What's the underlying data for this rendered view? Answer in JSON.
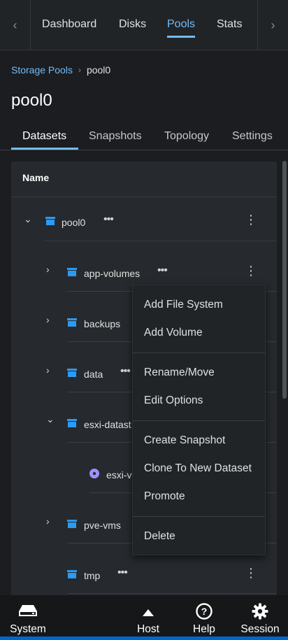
{
  "nav": {
    "tabs": [
      "Dashboard",
      "Disks",
      "Pools",
      "Stats"
    ],
    "active_tab": "Pools"
  },
  "breadcrumb": {
    "parent": "Storage Pools",
    "current": "pool0"
  },
  "page": {
    "title": "pool0"
  },
  "subtabs": [
    "Datasets",
    "Snapshots",
    "Topology",
    "Settings"
  ],
  "table": {
    "header": "Name"
  },
  "tree": {
    "root": "pool0",
    "children": [
      {
        "label": "app-volumes"
      },
      {
        "label": "backups"
      },
      {
        "label": "data"
      },
      {
        "label": "esxi-datast"
      },
      {
        "label": "esxi-v"
      },
      {
        "label": "pve-vms"
      },
      {
        "label": "tmp"
      }
    ]
  },
  "menu": {
    "items": [
      "Add File System",
      "Add Volume",
      "Rename/Move",
      "Edit Options",
      "Create Snapshot",
      "Clone To New Dataset",
      "Promote",
      "Delete"
    ]
  },
  "bottom_nav": {
    "items": [
      "System",
      "Host",
      "Help",
      "Session"
    ]
  },
  "colors": {
    "accent": "#73bcf7",
    "folder": "#2b9af3",
    "volume": "#a18fff",
    "background": "#1b1d21"
  }
}
